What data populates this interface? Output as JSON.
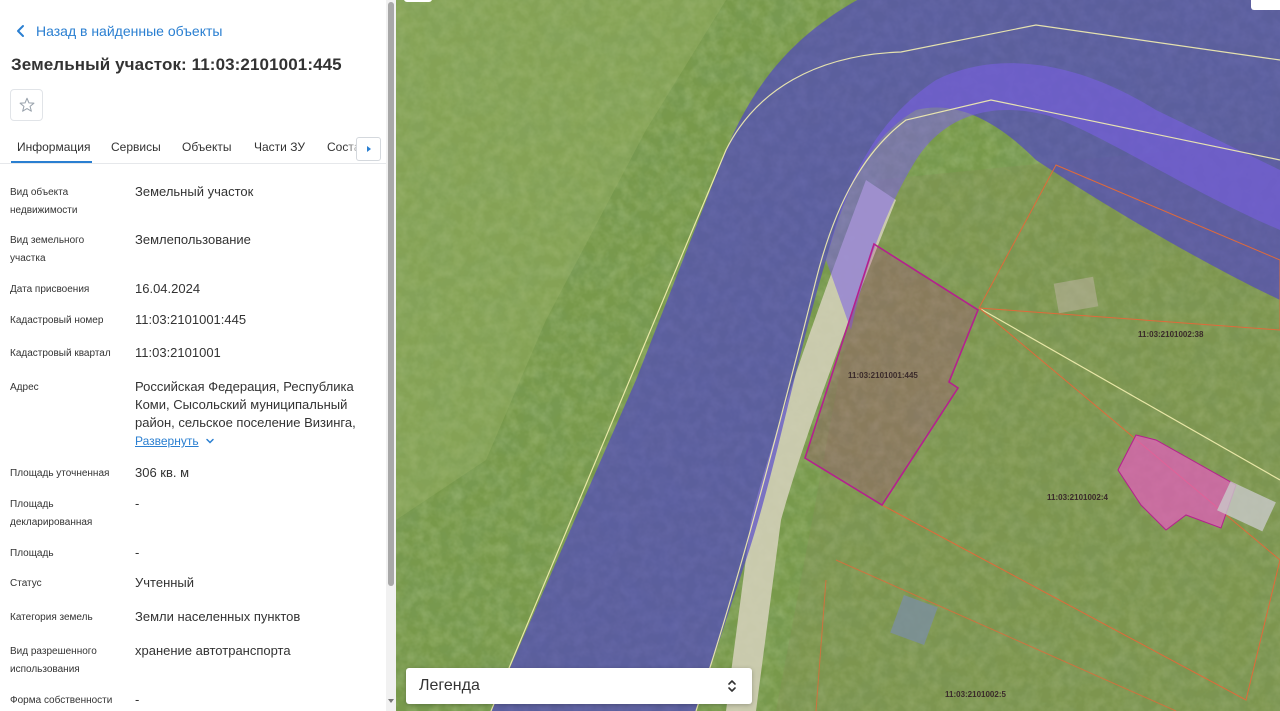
{
  "nav": {
    "back_label": "Назад в найденные объекты"
  },
  "title": "Земельный участок: 11:03:2101001:445",
  "tabs": [
    {
      "label": "Информация",
      "active": true
    },
    {
      "label": "Сервисы"
    },
    {
      "label": "Объекты"
    },
    {
      "label": "Части ЗУ"
    },
    {
      "label": "Соста"
    }
  ],
  "info": {
    "object_type": {
      "label_1": "Вид объекта",
      "label_2": "недвижимости",
      "value": "Земельный участок"
    },
    "land_type": {
      "label_1": "Вид земельного",
      "label_2": "участка",
      "value": "Землепользование"
    },
    "assign_date": {
      "label": "Дата присвоения",
      "value": "16.04.2024"
    },
    "cadastral_number": {
      "label": "Кадастровый номер",
      "value": "11:03:2101001:445"
    },
    "cadastral_quarter": {
      "label": "Кадастровый квартал",
      "value": "11:03:2101001"
    },
    "address": {
      "label": "Адрес",
      "line_1": "Российская Федерация, Республика",
      "line_2": "Коми, Сысольский муниципальный",
      "line_3": "район, сельское поселение Визинга,",
      "expand_label": "Развернуть"
    },
    "area_specified": {
      "label": "Площадь уточненная",
      "value": "306 кв. м"
    },
    "area_declared": {
      "label_1": "Площадь",
      "label_2": "декларированная",
      "value": "-"
    },
    "area": {
      "label": "Площадь",
      "value": "-"
    },
    "status": {
      "label": "Статус",
      "value": "Учтенный"
    },
    "land_category": {
      "label": "Категория земель",
      "value": "Земли населенных пунктов"
    },
    "permitted_use": {
      "label_1": "Вид разрешенного",
      "label_2": "использования",
      "value": "хранение автотранспорта"
    },
    "ownership": {
      "label": "Форма собственности",
      "value": "-"
    }
  },
  "map": {
    "legend_label": "Легенда",
    "parcels": {
      "selected": "11:03:2101001:445",
      "neighbor_1": "11:03:2101002:38",
      "neighbor_2": "11:03:2101002:4",
      "neighbor_3": "11:03:2101002:5"
    },
    "colors": {
      "zone_fill": "#4b3ccf",
      "selected_outline": "#b5208e",
      "neighbor_outline": "#e06a3a",
      "boundary_line": "#f4efb0",
      "accent": "#2a7fd1"
    }
  }
}
